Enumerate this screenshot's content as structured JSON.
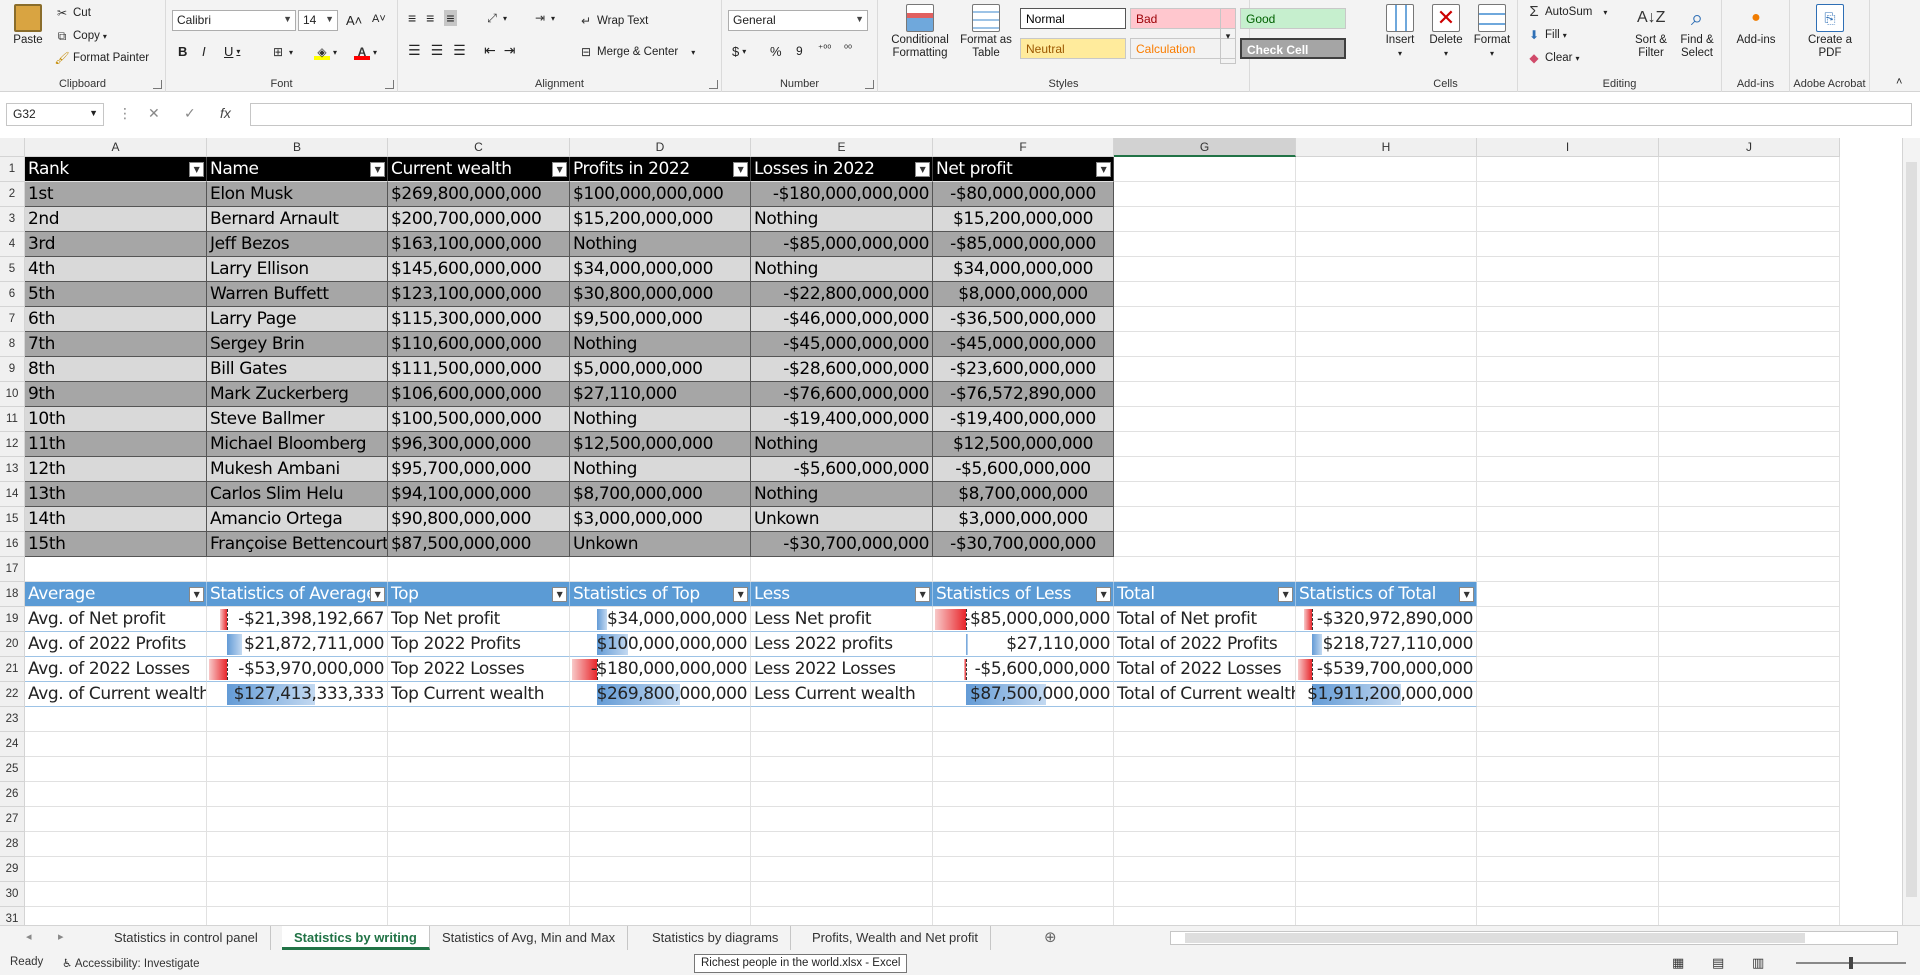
{
  "ribbon": {
    "clipboard": {
      "paste": "Paste",
      "cut": "Cut",
      "copy": "Copy",
      "format_painter": "Format Painter",
      "label": "Clipboard"
    },
    "font": {
      "name": "Calibri",
      "size": "14",
      "bold": "B",
      "italic": "I",
      "underline": "U",
      "label": "Font"
    },
    "alignment": {
      "wrap_text": "Wrap Text",
      "merge_center": "Merge & Center",
      "label": "Alignment"
    },
    "number": {
      "format": "General",
      "currency": "$",
      "percent": "%",
      "comma": "9",
      "label": "Number"
    },
    "styles": {
      "conditional": "Conditional Formatting",
      "format_table": "Format as Table",
      "cells": [
        {
          "name": "Normal",
          "bg": "#ffffff",
          "fg": "#000000"
        },
        {
          "name": "Bad",
          "bg": "#ffc7ce",
          "fg": "#9c0006"
        },
        {
          "name": "Good",
          "bg": "#c6efce",
          "fg": "#006100"
        },
        {
          "name": "Neutral",
          "bg": "#ffeb9c",
          "fg": "#9c5700"
        },
        {
          "name": "Calculation",
          "bg": "#f2f2f2",
          "fg": "#fa7d00"
        },
        {
          "name": "Check Cell",
          "bg": "#a5a5a5",
          "fg": "#ffffff"
        }
      ],
      "label": "Styles"
    },
    "cells": {
      "insert": "Insert",
      "delete": "Delete",
      "format": "Format",
      "label": "Cells"
    },
    "editing": {
      "autosum": "AutoSum",
      "fill": "Fill",
      "clear": "Clear",
      "sort": "Sort & Filter",
      "find": "Find & Select",
      "label": "Editing"
    },
    "addins": {
      "addins": "Add-ins",
      "label": "Add-ins"
    },
    "acrobat": {
      "create_pdf": "Create a PDF",
      "label": "Adobe Acrobat"
    }
  },
  "formula_bar": {
    "name_box": "G32",
    "cancel": "✕",
    "enter": "✓",
    "fx": "fx",
    "value": ""
  },
  "columns": [
    "A",
    "B",
    "C",
    "D",
    "E",
    "F",
    "G",
    "H",
    "I",
    "J"
  ],
  "rows": [
    "1",
    "2",
    "3",
    "4",
    "5",
    "6",
    "7",
    "8",
    "9",
    "10",
    "11",
    "12",
    "13",
    "14",
    "15",
    "16",
    "17",
    "18",
    "19",
    "20",
    "21",
    "22",
    "23",
    "24",
    "25",
    "26",
    "27",
    "28",
    "29",
    "30",
    "31"
  ],
  "table1": {
    "headers": [
      "Rank",
      "Name",
      "Current wealth",
      "Profits in 2022",
      "Losses in 2022",
      "Net profit"
    ],
    "rows": [
      [
        "1st",
        "Elon Musk",
        "$269,800,000,000",
        "$100,000,000,000",
        "-$180,000,000,000",
        "-$80,000,000,000"
      ],
      [
        "2nd",
        "Bernard Arnault",
        "$200,700,000,000",
        "$15,200,000,000",
        "Nothing",
        "$15,200,000,000"
      ],
      [
        "3rd",
        "Jeff Bezos",
        "$163,100,000,000",
        "Nothing",
        "-$85,000,000,000",
        "-$85,000,000,000"
      ],
      [
        "4th",
        "Larry Ellison",
        "$145,600,000,000",
        "$34,000,000,000",
        "Nothing",
        "$34,000,000,000"
      ],
      [
        "5th",
        "Warren Buffett",
        "$123,100,000,000",
        "$30,800,000,000",
        "-$22,800,000,000",
        "$8,000,000,000"
      ],
      [
        "6th",
        "Larry Page",
        "$115,300,000,000",
        "$9,500,000,000",
        "-$46,000,000,000",
        "-$36,500,000,000"
      ],
      [
        "7th",
        "Sergey Brin",
        "$110,600,000,000",
        "Nothing",
        "-$45,000,000,000",
        "-$45,000,000,000"
      ],
      [
        "8th",
        "Bill Gates",
        "$111,500,000,000",
        "$5,000,000,000",
        "-$28,600,000,000",
        "-$23,600,000,000"
      ],
      [
        "9th",
        "Mark Zuckerberg",
        "$106,600,000,000",
        "$27,110,000",
        "-$76,600,000,000",
        "-$76,572,890,000"
      ],
      [
        "10th",
        "Steve Ballmer",
        "$100,500,000,000",
        "Nothing",
        "-$19,400,000,000",
        "-$19,400,000,000"
      ],
      [
        "11th",
        "Michael Bloomberg",
        "$96,300,000,000",
        "$12,500,000,000",
        "Nothing",
        "$12,500,000,000"
      ],
      [
        "12th",
        "Mukesh Ambani",
        "$95,700,000,000",
        "Nothing",
        "-$5,600,000,000",
        "-$5,600,000,000"
      ],
      [
        "13th",
        "Carlos Slim Helu",
        "$94,100,000,000",
        "$8,700,000,000",
        "Nothing",
        "$8,700,000,000"
      ],
      [
        "14th",
        "Amancio Ortega",
        "$90,800,000,000",
        "$3,000,000,000",
        "Unkown",
        "$3,000,000,000"
      ],
      [
        "15th",
        "Françoise Bettencourt",
        "$87,500,000,000",
        "Unkown",
        "-$30,700,000,000",
        "-$30,700,000,000"
      ]
    ]
  },
  "table2": {
    "headers": [
      "Average",
      "Statistics of Average",
      "Top",
      "Statistics of Top",
      "Less",
      "Statistics of Less",
      "Total",
      "Statistics of Total"
    ],
    "rows": [
      [
        "Avg. of Net profit",
        "-$21,398,192,667",
        "Top Net profit",
        "$34,000,000,000",
        "Less Net profit",
        "-$85,000,000,000",
        "Total of Net profit",
        "-$320,972,890,000"
      ],
      [
        "Avg. of 2022 Profits",
        "$21,872,711,000",
        "Top 2022 Profits",
        "$100,000,000,000",
        "Less 2022 profits",
        "$27,110,000",
        "Total of 2022 Profits",
        "$218,727,110,000"
      ],
      [
        "Avg. of 2022 Losses",
        "-$53,970,000,000",
        "Top 2022 Losses",
        "-$180,000,000,000",
        "Less 2022 Losses",
        "-$5,600,000,000",
        "Total of 2022 Losses",
        "-$539,700,000,000"
      ],
      [
        "Avg. of Current wealth",
        "$127,413,333,333",
        "Top Current wealth",
        "$269,800,000,000",
        "Less Current wealth",
        "$87,500,000,000",
        "Total of Current wealth",
        "$1,911,200,000,000"
      ]
    ],
    "data_bars": [
      [
        -21398192667,
        34000000000,
        -85000000000,
        -320972890000
      ],
      [
        21872711000,
        100000000000,
        27110000,
        218727110000
      ],
      [
        -53970000000,
        -180000000000,
        -5600000000,
        -539700000000
      ],
      [
        127413333333,
        269800000000,
        87500000000,
        1911200000000
      ]
    ]
  },
  "sheets": [
    "Statistics in control panel",
    "Statistics by writing",
    "Statistics of Avg, Min and Max",
    "Statistics by diagrams",
    "Profits, Wealth and Net profit"
  ],
  "active_sheet": "Statistics by writing",
  "status": {
    "ready": "Ready",
    "accessibility": "Accessibility: Investigate",
    "tooltip": "Richest people in the world.xlsx - Excel"
  },
  "colors": {
    "table1_header": "#000000",
    "table1_dark": "#a6a6a6",
    "table1_light": "#d9d9d9",
    "table2_header": "#5b9bd5",
    "bar_negative": "#e8262b",
    "bar_positive": "#639bd6",
    "active_tab": "#217346"
  }
}
